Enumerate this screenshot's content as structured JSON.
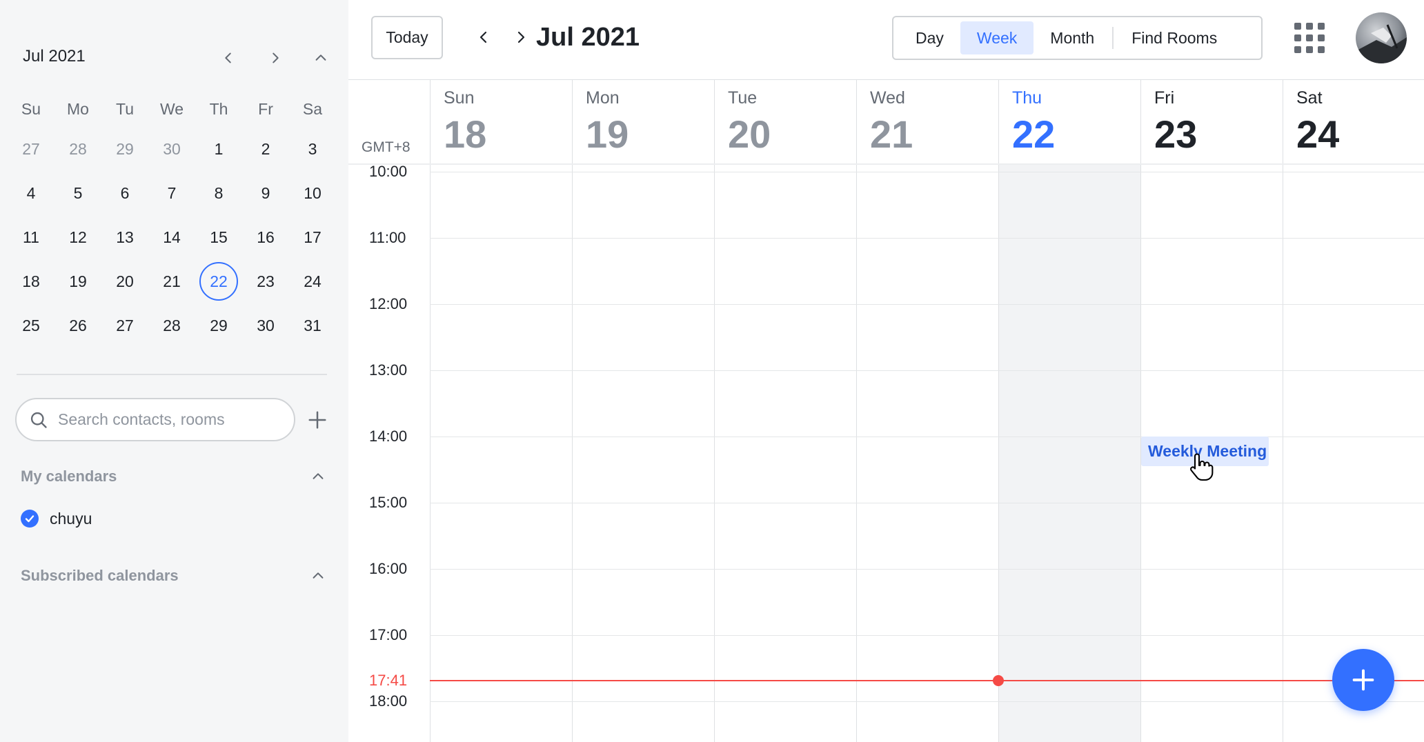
{
  "mini_calendar": {
    "title": "Jul 2021",
    "weekdays": [
      "Su",
      "Mo",
      "Tu",
      "We",
      "Th",
      "Fr",
      "Sa"
    ],
    "days": [
      {
        "n": "27",
        "muted": true
      },
      {
        "n": "28",
        "muted": true
      },
      {
        "n": "29",
        "muted": true
      },
      {
        "n": "30",
        "muted": true
      },
      {
        "n": "1"
      },
      {
        "n": "2"
      },
      {
        "n": "3"
      },
      {
        "n": "4"
      },
      {
        "n": "5"
      },
      {
        "n": "6"
      },
      {
        "n": "7"
      },
      {
        "n": "8"
      },
      {
        "n": "9"
      },
      {
        "n": "10"
      },
      {
        "n": "11"
      },
      {
        "n": "12"
      },
      {
        "n": "13"
      },
      {
        "n": "14"
      },
      {
        "n": "15"
      },
      {
        "n": "16"
      },
      {
        "n": "17"
      },
      {
        "n": "18"
      },
      {
        "n": "19"
      },
      {
        "n": "20"
      },
      {
        "n": "21"
      },
      {
        "n": "22",
        "today": true
      },
      {
        "n": "23"
      },
      {
        "n": "24"
      },
      {
        "n": "25"
      },
      {
        "n": "26"
      },
      {
        "n": "27"
      },
      {
        "n": "28"
      },
      {
        "n": "29"
      },
      {
        "n": "30"
      },
      {
        "n": "31"
      }
    ]
  },
  "search": {
    "placeholder": "Search contacts, rooms"
  },
  "my_calendars": {
    "title": "My calendars",
    "items": [
      {
        "name": "chuyu",
        "checked": true
      }
    ]
  },
  "subscribed_calendars": {
    "title": "Subscribed calendars"
  },
  "toolbar": {
    "today_label": "Today",
    "title": "Jul 2021",
    "views": [
      {
        "label": "Day",
        "active": false
      },
      {
        "label": "Week",
        "active": true
      },
      {
        "label": "Month",
        "active": false
      },
      {
        "label": "Find Rooms",
        "active": false
      }
    ]
  },
  "week": {
    "timezone": "GMT+8",
    "days": [
      {
        "name": "Sun",
        "num": "18",
        "state": "past"
      },
      {
        "name": "Mon",
        "num": "19",
        "state": "past"
      },
      {
        "name": "Tue",
        "num": "20",
        "state": "past"
      },
      {
        "name": "Wed",
        "num": "21",
        "state": "past"
      },
      {
        "name": "Thu",
        "num": "22",
        "state": "today"
      },
      {
        "name": "Fri",
        "num": "23",
        "state": "future"
      },
      {
        "name": "Sat",
        "num": "24",
        "state": "future"
      }
    ],
    "hours": [
      "10:00",
      "11:00",
      "12:00",
      "13:00",
      "14:00",
      "15:00",
      "16:00",
      "17:00",
      "18:00"
    ],
    "first_hour": 10,
    "now": {
      "label": "17:41",
      "hour": 17.683
    },
    "events": [
      {
        "title": "Weekly Meeting",
        "day_index": 5,
        "start": 14.0,
        "end": 14.45
      }
    ]
  },
  "colors": {
    "accent": "#3370ff",
    "now_line": "#f54a45",
    "event_bg": "#e1eaff",
    "event_text": "#245bdb"
  },
  "icons": {
    "mini_prev": "chevron-left-icon",
    "mini_next": "chevron-right-icon",
    "mini_collapse": "chevron-up-icon",
    "search": "search-icon",
    "add": "plus-icon",
    "apps": "grid-icon",
    "fab": "plus-icon"
  }
}
